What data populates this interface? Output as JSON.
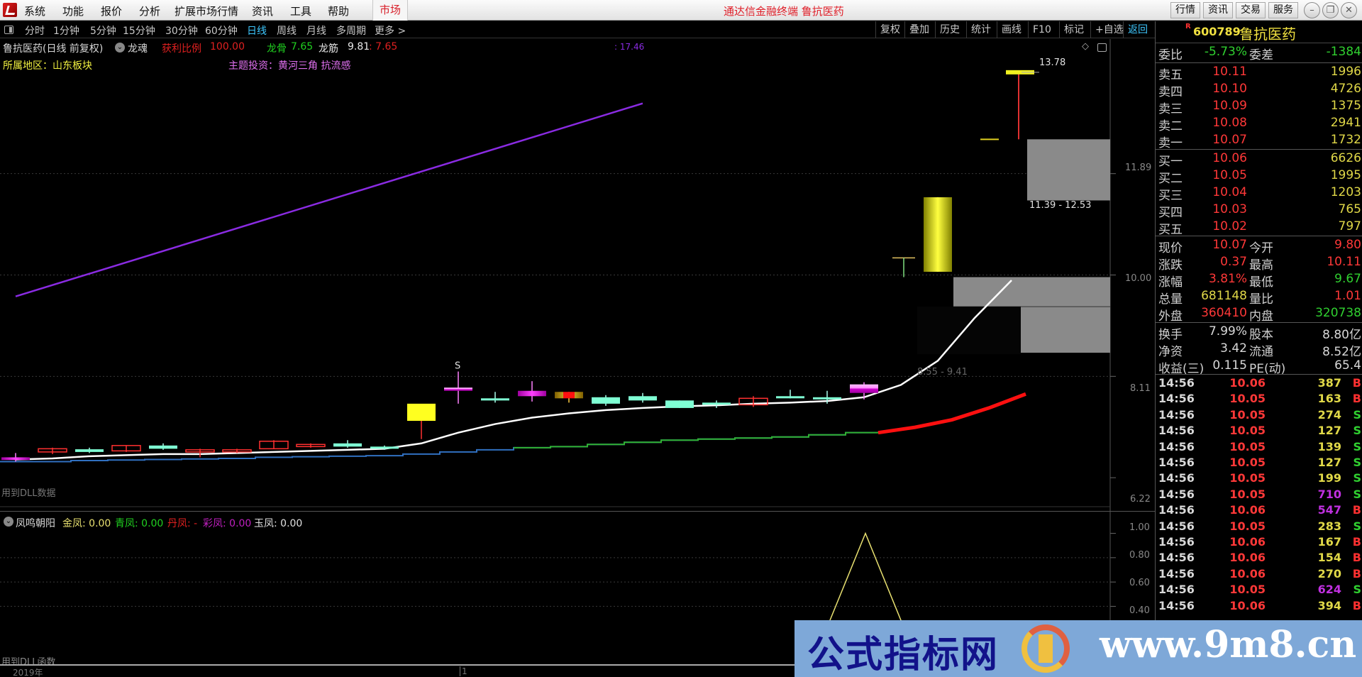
{
  "menubar": {
    "items": [
      "系统",
      "功能",
      "报价",
      "分析",
      "扩展市场行情",
      "资讯",
      "工具",
      "帮助"
    ],
    "market": "市场",
    "title": "通达信金融终端 鲁抗医药",
    "right_buttons": [
      "行情",
      "资讯",
      "交易",
      "服务"
    ],
    "window_controls": [
      "minimize",
      "restore",
      "close"
    ]
  },
  "period_bar": {
    "periods": [
      "分时",
      "1分钟",
      "5分钟",
      "15分钟",
      "30分钟",
      "60分钟",
      "日线",
      "周线",
      "月线",
      "多周期",
      "更多 >"
    ],
    "active_period": "日线",
    "tools": [
      "复权",
      "叠加",
      "历史",
      "统计",
      "画线",
      "F10",
      "标记",
      "+自选",
      "返回"
    ],
    "active_tool": "返回"
  },
  "chart_info": {
    "title": "鲁抗医药(日线 前复权)",
    "indicator_name": "龙魂",
    "profit_label": "获利比例",
    "profit_value": "100.00",
    "bone_label": "龙骨",
    "bone_value": "7.65",
    "tendon_label": "龙筋",
    "tendon_value": "9.81",
    "extra_value": ": 7.65",
    "region_label": "所属地区：山东板块",
    "theme_label": "主题投资：黄河三角 抗流感",
    "line_top_label": ": 17.46",
    "high_marker": "13.78",
    "zone_upper_label": "11.39 - 12.53",
    "zone_lower_label": "8.55 - 9.41",
    "signal_label": "S",
    "dll_note_main": "用到DLL数据",
    "colors": {
      "up": "#ff3030",
      "down": "#7fffd4",
      "line_purple": "#8a2be2",
      "zone_gray": "#8a8a8a"
    }
  },
  "chart_data": {
    "type": "candlestick",
    "title": "鲁抗医药(日线 前复权)",
    "y_axis_ticks": [
      "11.89",
      "10.00",
      "8.11",
      "6.22"
    ],
    "ylim": [
      5.6,
      14.4
    ],
    "candles": [
      {
        "o": 6.6,
        "h": 6.68,
        "l": 6.52,
        "c": 6.55,
        "style": "magenta"
      },
      {
        "o": 6.7,
        "h": 6.78,
        "l": 6.66,
        "c": 6.76,
        "style": "up"
      },
      {
        "o": 6.75,
        "h": 6.78,
        "l": 6.68,
        "c": 6.7,
        "style": "down"
      },
      {
        "o": 6.72,
        "h": 6.82,
        "l": 6.7,
        "c": 6.82,
        "style": "up"
      },
      {
        "o": 6.82,
        "h": 6.86,
        "l": 6.74,
        "c": 6.76,
        "style": "down"
      },
      {
        "o": 6.7,
        "h": 6.76,
        "l": 6.6,
        "c": 6.74,
        "style": "up"
      },
      {
        "o": 6.7,
        "h": 6.76,
        "l": 6.68,
        "c": 6.74,
        "style": "up"
      },
      {
        "o": 6.76,
        "h": 6.92,
        "l": 6.76,
        "c": 6.9,
        "style": "up"
      },
      {
        "o": 6.8,
        "h": 6.86,
        "l": 6.78,
        "c": 6.84,
        "style": "up"
      },
      {
        "o": 6.86,
        "h": 6.92,
        "l": 6.78,
        "c": 6.8,
        "style": "down"
      },
      {
        "o": 6.8,
        "h": 6.82,
        "l": 6.74,
        "c": 6.76,
        "style": "down"
      },
      {
        "o": 7.28,
        "h": 7.3,
        "l": 6.94,
        "c": 7.6,
        "style": "yellow"
      },
      {
        "o": 7.9,
        "h": 8.2,
        "l": 7.6,
        "c": 7.84,
        "style": "pink",
        "signal": "S"
      },
      {
        "o": 7.7,
        "h": 7.82,
        "l": 7.62,
        "c": 7.66,
        "style": "down"
      },
      {
        "o": 7.84,
        "h": 8.02,
        "l": 7.64,
        "c": 7.74,
        "style": "magenta"
      },
      {
        "o": 7.82,
        "h": 7.82,
        "l": 7.62,
        "c": 7.7,
        "style": "red-gold"
      },
      {
        "o": 7.72,
        "h": 7.76,
        "l": 7.56,
        "c": 7.6,
        "style": "down"
      },
      {
        "o": 7.74,
        "h": 7.8,
        "l": 7.62,
        "c": 7.66,
        "style": "down"
      },
      {
        "o": 7.66,
        "h": 7.66,
        "l": 7.52,
        "c": 7.52,
        "style": "down"
      },
      {
        "o": 7.62,
        "h": 7.66,
        "l": 7.52,
        "c": 7.58,
        "style": "down"
      },
      {
        "o": 7.58,
        "h": 7.74,
        "l": 7.54,
        "c": 7.7,
        "style": "up"
      },
      {
        "o": 7.74,
        "h": 7.86,
        "l": 7.7,
        "c": 7.72,
        "style": "down"
      },
      {
        "o": 7.72,
        "h": 7.84,
        "l": 7.6,
        "c": 7.68,
        "style": "down"
      },
      {
        "o": 7.8,
        "h": 8.0,
        "l": 7.68,
        "c": 7.96,
        "style": "pink"
      },
      {
        "o": 10.1,
        "h": 10.32,
        "l": 9.98,
        "c": 10.12,
        "style": "down-t"
      },
      {
        "o": 10.06,
        "h": 11.45,
        "l": 10.06,
        "c": 11.45,
        "style": "yellow-cyl"
      },
      {
        "o": 12.53,
        "h": 13.78,
        "l": 12.5,
        "c": 12.53,
        "style": "doji-yellow"
      }
    ],
    "series": [
      {
        "name": "trend_purple",
        "points": [
          [
            0,
            9.6
          ],
          [
            17,
            13.2
          ]
        ]
      },
      {
        "name": "white_ma",
        "values": [
          6.56,
          6.58,
          6.62,
          6.64,
          6.66,
          6.66,
          6.68,
          6.7,
          6.72,
          6.74,
          6.76,
          6.86,
          7.06,
          7.22,
          7.34,
          7.42,
          7.48,
          7.52,
          7.55,
          7.57,
          7.6,
          7.62,
          7.65,
          7.72,
          7.95,
          8.4,
          9.2,
          9.9
        ]
      },
      {
        "name": "green_blue_ma",
        "values": [
          6.52,
          6.52,
          6.54,
          6.55,
          6.56,
          6.57,
          6.58,
          6.6,
          6.61,
          6.62,
          6.63,
          6.66,
          6.7,
          6.74,
          6.78,
          6.8,
          6.84,
          6.88,
          6.92,
          6.94,
          6.96,
          6.98,
          7.02,
          7.06
        ]
      },
      {
        "name": "red_projection",
        "values": [
          7.06,
          7.16,
          7.3,
          7.52,
          7.78
        ]
      }
    ],
    "zones": [
      {
        "label": "11.39 - 12.53",
        "low": 11.39,
        "high": 12.53,
        "color": "#8a8a8a"
      },
      {
        "label": "8.55 - 9.41",
        "low": 8.55,
        "high": 9.96,
        "color": "#8a8a8a"
      }
    ]
  },
  "indicator": {
    "name": "凤鸣朝阳",
    "fields": [
      {
        "label": "金凤",
        "value": "0.00",
        "color": "#e8e070"
      },
      {
        "label": "青凤",
        "value": "0.00",
        "color": "#20d020"
      },
      {
        "label": "丹凤",
        "value": "-",
        "color": "#e02020"
      },
      {
        "label": "彩凤",
        "value": "0.00",
        "color": "#c020c0"
      },
      {
        "label": "玉凤",
        "value": "0.00",
        "color": "#e0e0e0"
      }
    ],
    "y_ticks": [
      "1.00",
      "0.80",
      "0.60",
      "0.40"
    ],
    "ylim": [
      0,
      1.05
    ],
    "spike_value": 1.0,
    "dll_note": "用到DLL函数",
    "x_label": "2019年",
    "x_marker": "1"
  },
  "quote": {
    "code": "600789",
    "name": "鲁抗医药",
    "badge": "R",
    "ratio": {
      "label": "委比",
      "value": "-5.73%",
      "label2": "委差",
      "value2": "-1384"
    },
    "asks": [
      {
        "label": "卖五",
        "price": "10.11",
        "vol": "1996"
      },
      {
        "label": "卖四",
        "price": "10.10",
        "vol": "4726"
      },
      {
        "label": "卖三",
        "price": "10.09",
        "vol": "1375"
      },
      {
        "label": "卖二",
        "price": "10.08",
        "vol": "2941"
      },
      {
        "label": "卖一",
        "price": "10.07",
        "vol": "1732"
      }
    ],
    "bids": [
      {
        "label": "买一",
        "price": "10.06",
        "vol": "6626"
      },
      {
        "label": "买二",
        "price": "10.05",
        "vol": "1995"
      },
      {
        "label": "买三",
        "price": "10.04",
        "vol": "1203"
      },
      {
        "label": "买四",
        "price": "10.03",
        "vol": "765"
      },
      {
        "label": "买五",
        "price": "10.02",
        "vol": "797"
      }
    ],
    "stats": [
      {
        "l1": "现价",
        "v1": "10.07",
        "c1": "#ff3838",
        "l2": "今开",
        "v2": "9.80",
        "c2": "#ff3838"
      },
      {
        "l1": "涨跌",
        "v1": "0.37",
        "c1": "#ff3838",
        "l2": "最高",
        "v2": "10.11",
        "c2": "#ff3838"
      },
      {
        "l1": "涨幅",
        "v1": "3.81%",
        "c1": "#ff3838",
        "l2": "最低",
        "v2": "9.67",
        "c2": "#30d030"
      },
      {
        "l1": "总量",
        "v1": "681148",
        "c1": "#e0d848",
        "l2": "量比",
        "v2": "1.01",
        "c2": "#ff3838"
      },
      {
        "l1": "外盘",
        "v1": "360410",
        "c1": "#ff3838",
        "l2": "内盘",
        "v2": "320738",
        "c2": "#30d030"
      }
    ],
    "fundamentals": [
      {
        "l1": "换手",
        "v1": "7.99%",
        "l2": "股本",
        "v2": "8.80亿"
      },
      {
        "l1": "净资",
        "v1": "3.42",
        "l2": "流通",
        "v2": "8.52亿"
      },
      {
        "l1": "收益(三)",
        "v1": "0.115",
        "l2": "PE(动)",
        "v2": "65.4"
      }
    ],
    "ticks": [
      {
        "time": "14:56",
        "price": "10.06",
        "vol": "387",
        "side": "B"
      },
      {
        "time": "14:56",
        "price": "10.05",
        "vol": "163",
        "side": "B"
      },
      {
        "time": "14:56",
        "price": "10.05",
        "vol": "274",
        "side": "S"
      },
      {
        "time": "14:56",
        "price": "10.05",
        "vol": "127",
        "side": "S"
      },
      {
        "time": "14:56",
        "price": "10.05",
        "vol": "139",
        "side": "S"
      },
      {
        "time": "14:56",
        "price": "10.05",
        "vol": "127",
        "side": "S"
      },
      {
        "time": "14:56",
        "price": "10.05",
        "vol": "199",
        "side": "S"
      },
      {
        "time": "14:56",
        "price": "10.05",
        "vol": "710",
        "side": "S",
        "big": true
      },
      {
        "time": "14:56",
        "price": "10.06",
        "vol": "547",
        "side": "B",
        "big": true
      },
      {
        "time": "14:56",
        "price": "10.05",
        "vol": "283",
        "side": "S"
      },
      {
        "time": "14:56",
        "price": "10.06",
        "vol": "167",
        "side": "B"
      },
      {
        "time": "14:56",
        "price": "10.06",
        "vol": "154",
        "side": "B"
      },
      {
        "time": "14:56",
        "price": "10.06",
        "vol": "270",
        "side": "B"
      },
      {
        "time": "14:56",
        "price": "10.05",
        "vol": "624",
        "side": "S",
        "big": true
      },
      {
        "time": "14:56",
        "price": "10.06",
        "vol": "394",
        "side": "B"
      }
    ]
  },
  "watermark": {
    "cn": "公式指标网",
    "url": "www.9m8.cn"
  }
}
